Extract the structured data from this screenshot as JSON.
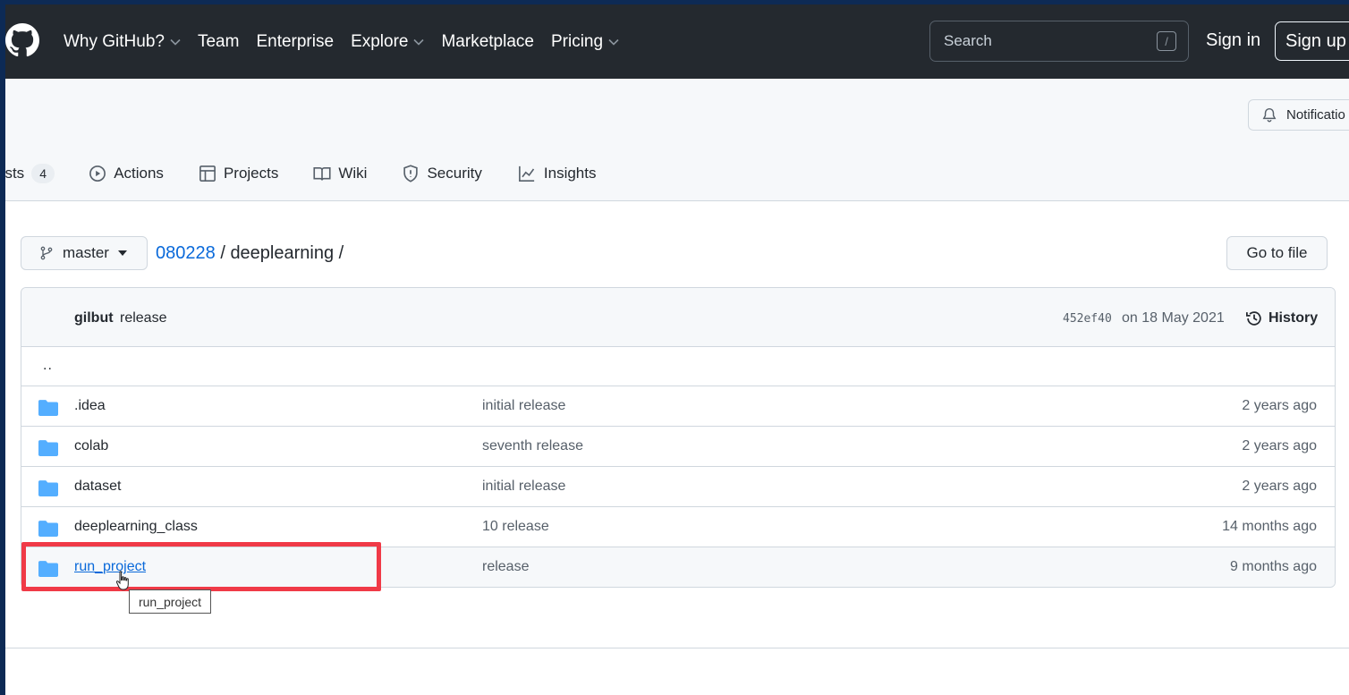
{
  "header": {
    "nav": [
      {
        "label": "Why GitHub?",
        "dropdown": true
      },
      {
        "label": "Team",
        "dropdown": false
      },
      {
        "label": "Enterprise",
        "dropdown": false
      },
      {
        "label": "Explore",
        "dropdown": true
      },
      {
        "label": "Marketplace",
        "dropdown": false
      },
      {
        "label": "Pricing",
        "dropdown": true
      }
    ],
    "search_placeholder": "Search",
    "search_shortcut": "/",
    "signin": "Sign in",
    "signup": "Sign up"
  },
  "repo": {
    "notifications_label": "Notificatio",
    "tabs": [
      {
        "label": "ests",
        "icon": "pull-request-icon",
        "count": "4"
      },
      {
        "label": "Actions",
        "icon": "play-icon"
      },
      {
        "label": "Projects",
        "icon": "table-icon"
      },
      {
        "label": "Wiki",
        "icon": "book-icon"
      },
      {
        "label": "Security",
        "icon": "shield-icon"
      },
      {
        "label": "Insights",
        "icon": "graph-icon"
      }
    ]
  },
  "path": {
    "branch": "master",
    "owner": "080228",
    "sep1": "/",
    "repo": "deeplearning",
    "sep2": "/",
    "go_to_file": "Go to file"
  },
  "commit": {
    "author": "gilbut",
    "message": "release",
    "sha": "452ef40",
    "date": "on 18 May 2021",
    "history_label": "History"
  },
  "parent_dir": "..",
  "files": [
    {
      "name": ".idea",
      "message": "initial release",
      "age": "2 years ago"
    },
    {
      "name": "colab",
      "message": "seventh release",
      "age": "2 years ago"
    },
    {
      "name": "dataset",
      "message": "initial release",
      "age": "2 years ago"
    },
    {
      "name": "deeplearning_class",
      "message": "10 release",
      "age": "14 months ago"
    },
    {
      "name": "run_project",
      "message": "release",
      "age": "9 months ago"
    }
  ],
  "tooltip": "run_project",
  "colors": {
    "header_bg": "#24292f",
    "link": "#0969da",
    "folder": "#54aeff",
    "highlight": "#f03a47"
  }
}
